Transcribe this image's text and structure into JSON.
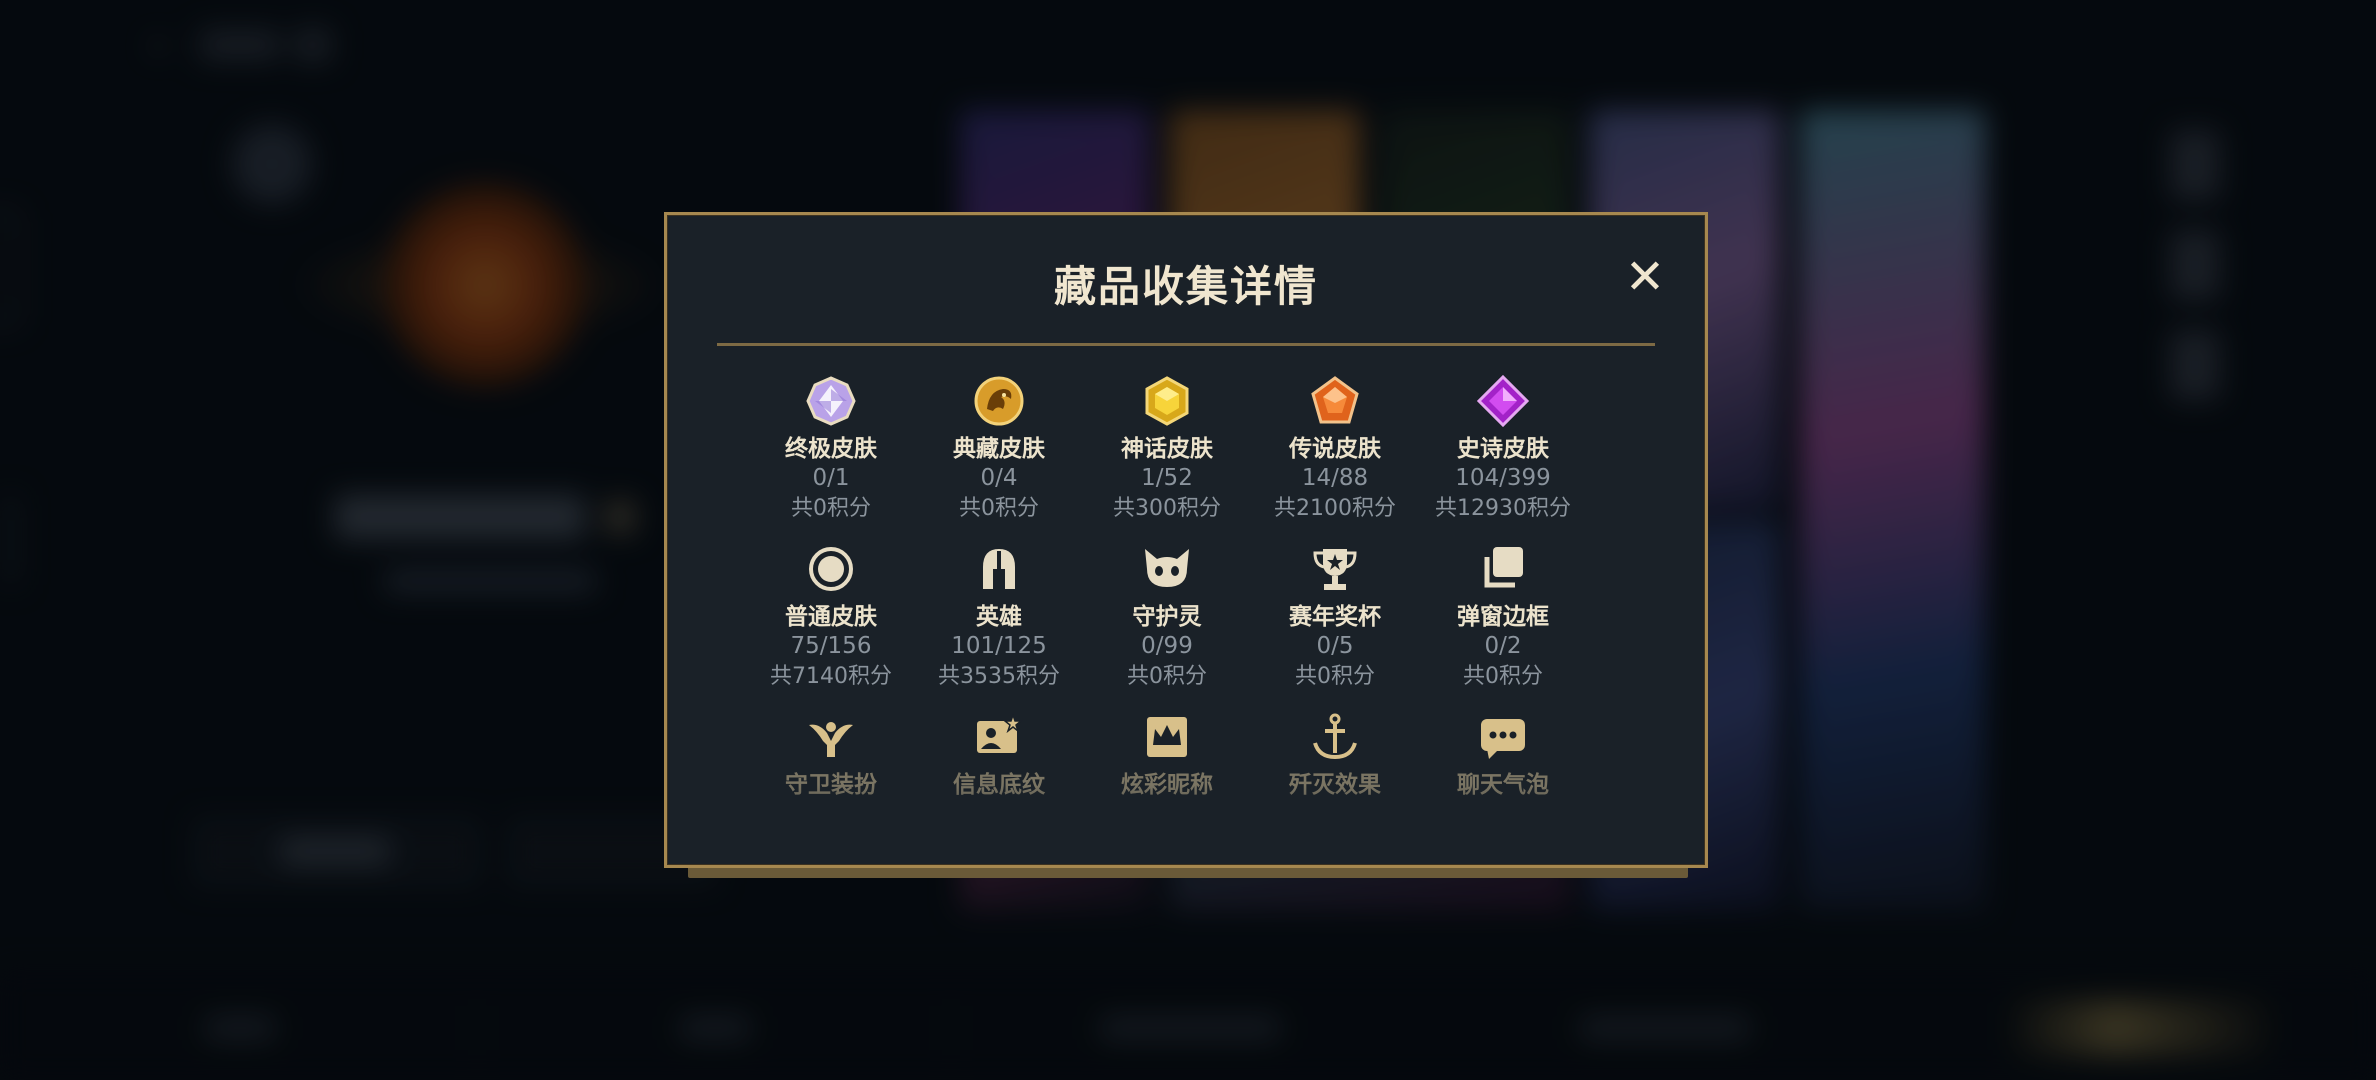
{
  "modal": {
    "title": "藏品收集详情",
    "close_glyph": "✕"
  },
  "categories": [
    {
      "name": "终极皮肤",
      "count": "0/1",
      "points": "共0积分",
      "icon": "ultimate-gem-icon"
    },
    {
      "name": "典藏皮肤",
      "count": "0/4",
      "points": "共0积分",
      "icon": "dragon-medal-icon"
    },
    {
      "name": "神话皮肤",
      "count": "1/52",
      "points": "共300积分",
      "icon": "mythic-gem-icon"
    },
    {
      "name": "传说皮肤",
      "count": "14/88",
      "points": "共2100积分",
      "icon": "legendary-gem-icon"
    },
    {
      "name": "史诗皮肤",
      "count": "104/399",
      "points": "共12930积分",
      "icon": "epic-gem-icon"
    },
    {
      "name": "普通皮肤",
      "count": "75/156",
      "points": "共7140积分",
      "icon": "ring-icon"
    },
    {
      "name": "英雄",
      "count": "101/125",
      "points": "共3535积分",
      "icon": "helmet-icon"
    },
    {
      "name": "守护灵",
      "count": "0/99",
      "points": "共0积分",
      "icon": "cat-face-icon"
    },
    {
      "name": "赛年奖杯",
      "count": "0/5",
      "points": "共0积分",
      "icon": "trophy-icon"
    },
    {
      "name": "弹窗边框",
      "count": "0/2",
      "points": "共0积分",
      "icon": "frames-icon"
    },
    {
      "name": "守卫装扮",
      "icon": "ward-icon"
    },
    {
      "name": "信息底纹",
      "icon": "card-star-icon"
    },
    {
      "name": "炫彩昵称",
      "icon": "crown-card-icon"
    },
    {
      "name": "歼灭效果",
      "icon": "anchor-icon"
    },
    {
      "name": "聊天气泡",
      "icon": "chat-bubble-icon"
    }
  ],
  "colors": {
    "modal_bg": "#1a2128",
    "modal_border": "#a6884f",
    "title": "#f0e6cf",
    "label": "#ece3cc",
    "muted": "#8b949d",
    "icon_gold": "#d8c08a"
  }
}
